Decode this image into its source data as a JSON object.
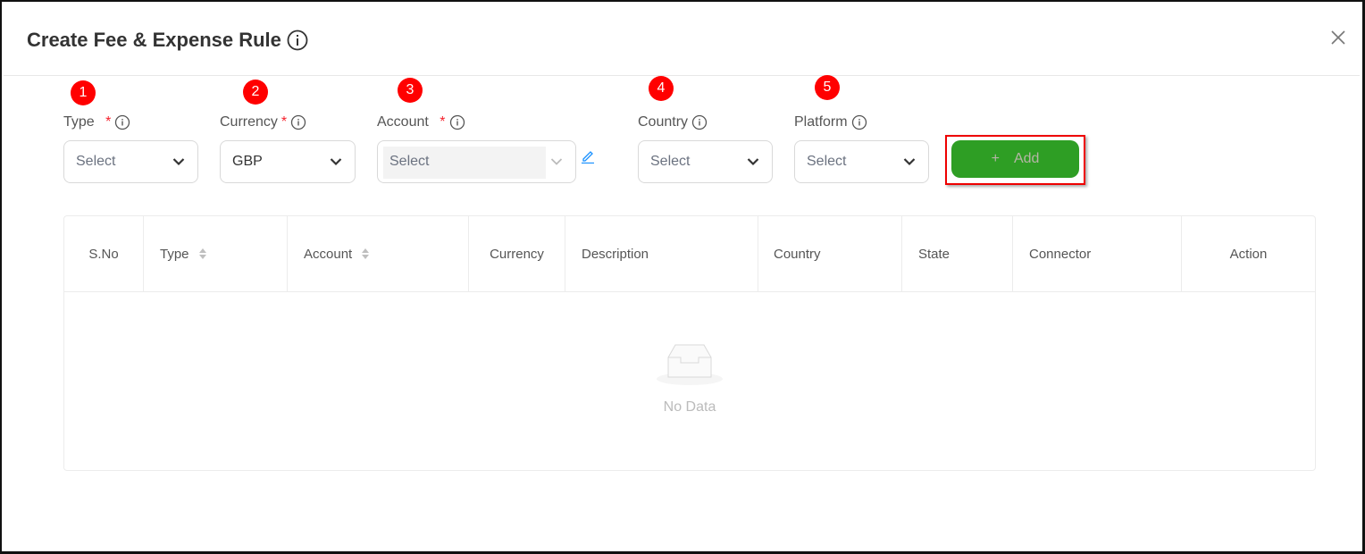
{
  "dialog": {
    "title": "Create Fee & Expense Rule",
    "title_icon": "info-icon",
    "close_icon": "close-icon"
  },
  "steps": [
    "1",
    "2",
    "3",
    "4",
    "5"
  ],
  "fields": {
    "type": {
      "label": "Type",
      "required": "*",
      "value": "Select"
    },
    "currency": {
      "label": "Currency",
      "required": "*",
      "value": "GBP"
    },
    "account": {
      "label": "Account",
      "required": "*",
      "value": "Select",
      "edit_icon": "pencil-icon"
    },
    "country": {
      "label": "Country",
      "value": "Select"
    },
    "platform": {
      "label": "Platform",
      "value": "Select"
    }
  },
  "add_button": {
    "icon": "+",
    "label": "Add",
    "color": "#2e9e24"
  },
  "table": {
    "columns": [
      "S.No",
      "Type",
      "Account",
      "Currency",
      "Description",
      "Country",
      "State",
      "Connector",
      "Action"
    ],
    "empty_text": "No Data"
  }
}
